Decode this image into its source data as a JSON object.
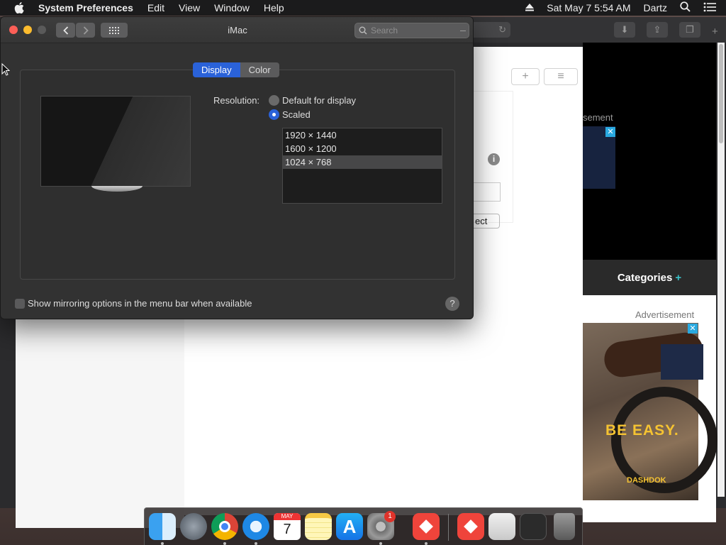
{
  "menubar": {
    "app_name": "System Preferences",
    "menus": [
      "Edit",
      "View",
      "Window",
      "Help"
    ],
    "datetime": "Sat May 7  5:54 AM",
    "user": "Dartz"
  },
  "background_page": {
    "advertisement_label_top": "sement",
    "advertisement_label_bottom": "Advertisement",
    "categories_label": "Categories",
    "categories_plus": "+",
    "ad_slogan": "BE EASY.",
    "ad_brand": "DASHDOK",
    "button_fragment": "ect",
    "close_glyph": "✕"
  },
  "window": {
    "title": "iMac",
    "search_placeholder": "Search",
    "tabs": [
      {
        "label": "Display",
        "active": true
      },
      {
        "label": "Color",
        "active": false
      }
    ],
    "resolution_label": "Resolution:",
    "resolution_options": [
      {
        "label": "Default for display",
        "selected": false
      },
      {
        "label": "Scaled",
        "selected": true
      }
    ],
    "scaled_list": [
      "1920 × 1440",
      "1600 × 1200",
      "1024 × 768"
    ],
    "scaled_selected_index": 2,
    "mirroring_checkbox_label": "Show mirroring options in the menu bar when available",
    "mirroring_checked": false,
    "help_glyph": "?"
  },
  "dock": {
    "apps": [
      "Finder",
      "Launchpad",
      "Chrome",
      "Safari",
      "Calendar",
      "Notes",
      "App Store",
      "System Preferences",
      "AnyDesk",
      "AnyDesk",
      "Preview",
      "Files",
      "Screenshot",
      "Trash"
    ],
    "calendar_month": "MAY",
    "calendar_day": "7",
    "system_prefs_badge": "1"
  },
  "colors": {
    "accent_blue": "#2a62d9",
    "window_bg": "#323232",
    "menubar_bg": "#1b1b1c"
  }
}
